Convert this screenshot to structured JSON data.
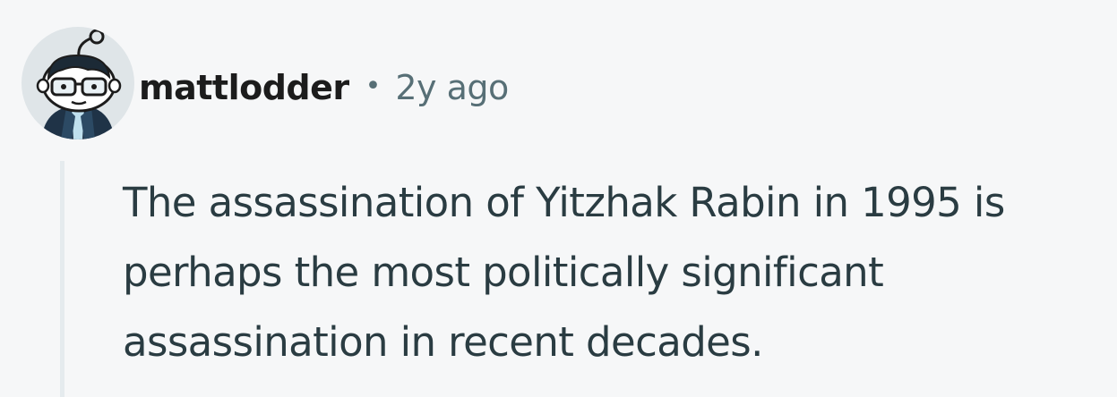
{
  "comment": {
    "author": {
      "username": "mattlodder",
      "avatar_icon": "snoo-avatar-icon"
    },
    "separator": "•",
    "timestamp": "2y ago",
    "body_lines": [
      "The assassination of Yitzhak Rabin in 1995 is",
      "perhaps the most politically significant",
      "assassination in recent decades."
    ]
  },
  "colors": {
    "background": "#f6f7f8",
    "username": "#1c1c1c",
    "meta": "#576f76",
    "body": "#2a3c42",
    "thread_line": "#e5ebee"
  }
}
